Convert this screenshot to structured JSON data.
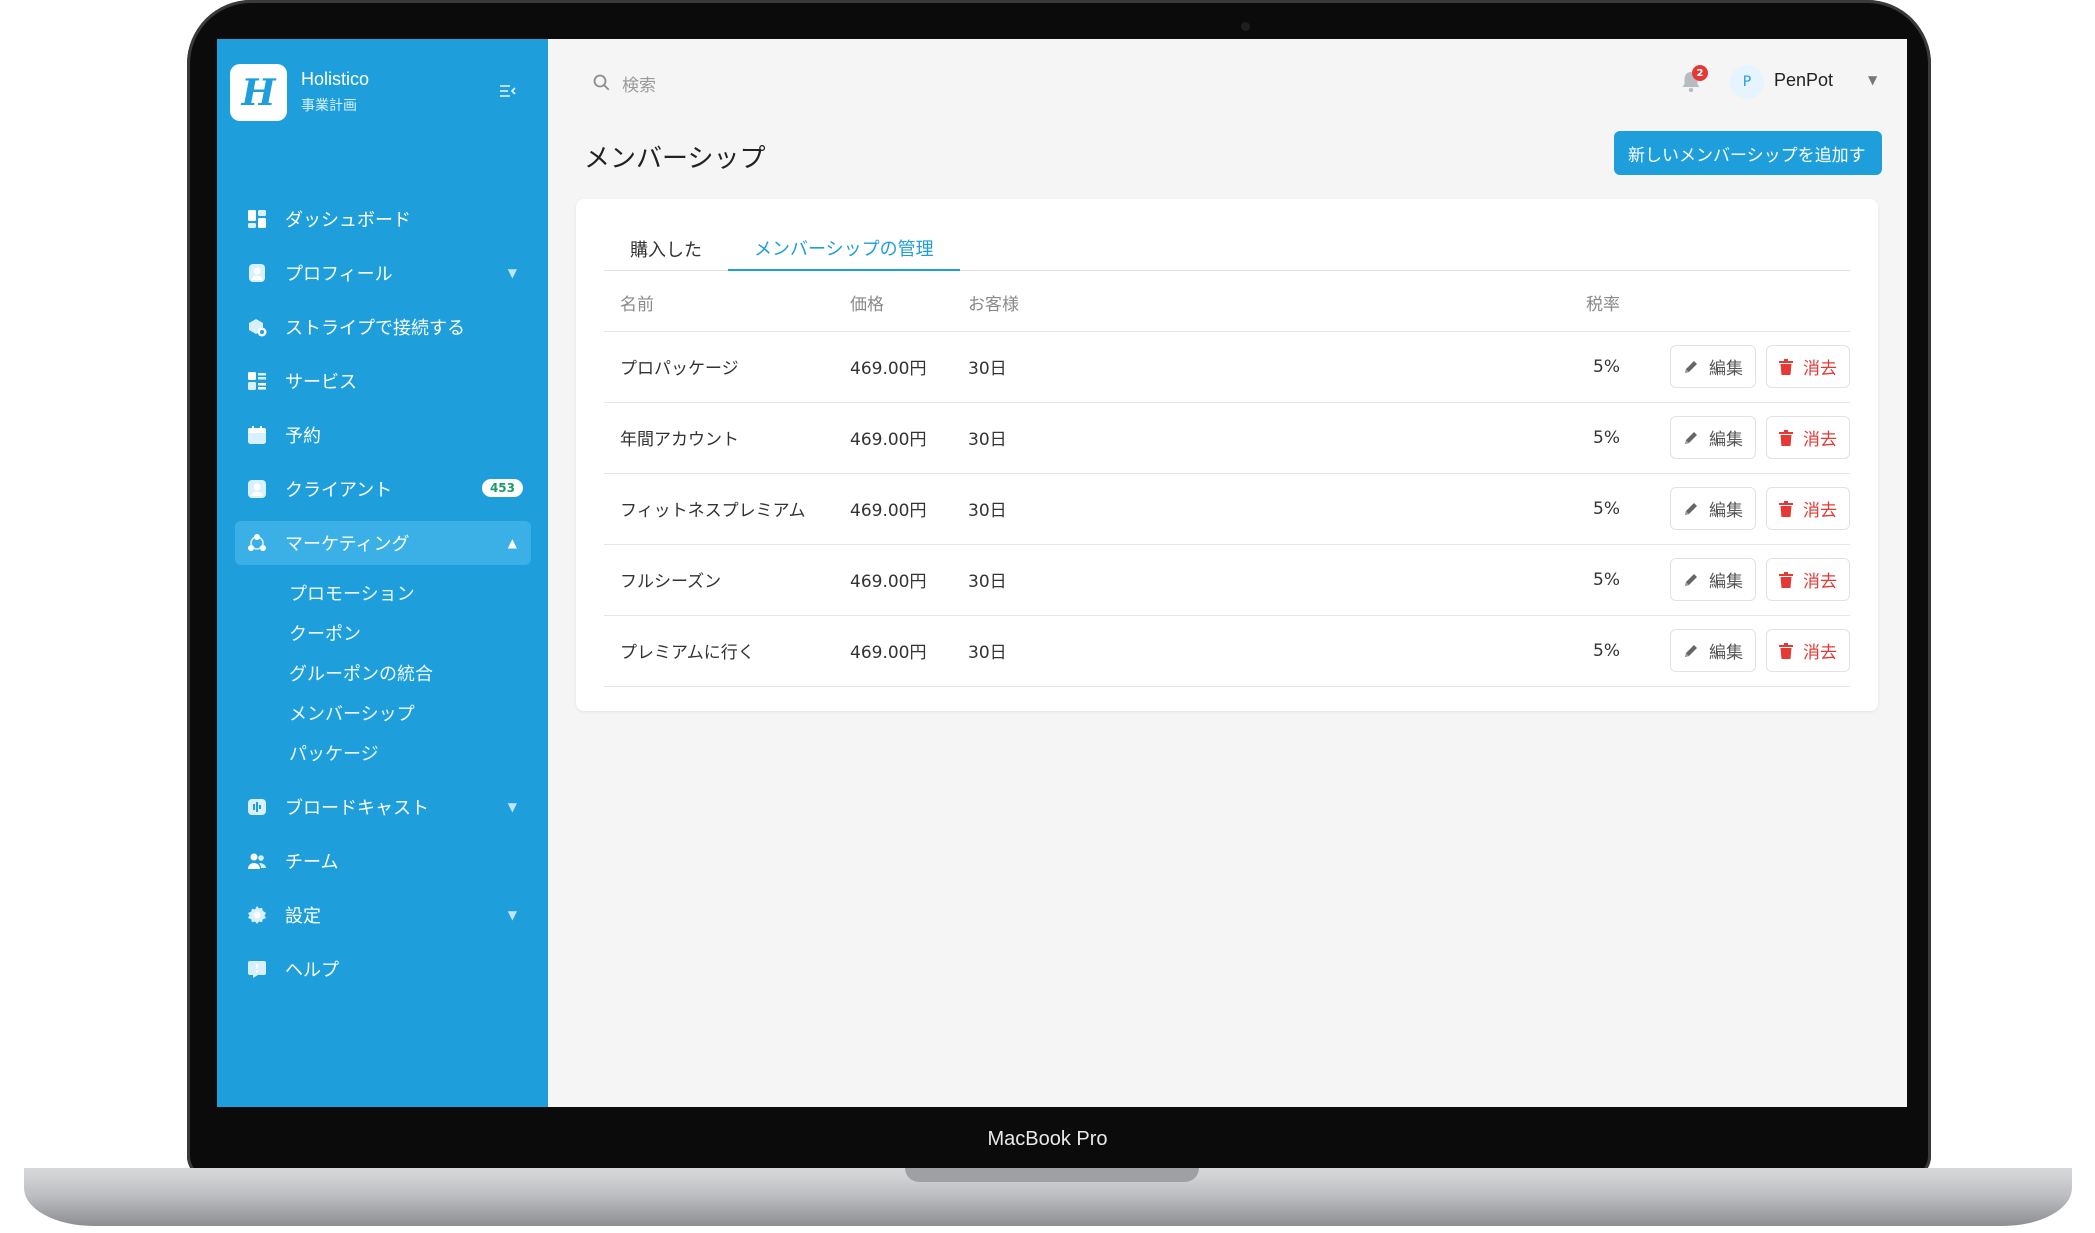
{
  "device": {
    "label": "MacBook Pro"
  },
  "sidebar": {
    "logo_letter": "H",
    "app_name": "Holistico",
    "app_sub": "事業計画",
    "nav": [
      {
        "label": "ダッシュボード",
        "icon": "dashboard-icon"
      },
      {
        "label": "プロフィール",
        "icon": "profile-icon",
        "expandable": true
      },
      {
        "label": "ストライプで接続する",
        "icon": "stripe-connect-icon"
      },
      {
        "label": "サービス",
        "icon": "services-icon"
      },
      {
        "label": "予約",
        "icon": "calendar-icon"
      },
      {
        "label": "クライアント",
        "icon": "client-icon",
        "badge": "453"
      },
      {
        "label": "マーケティング",
        "icon": "marketing-icon",
        "expanded": true
      },
      {
        "label": "ブロードキャスト",
        "icon": "broadcast-icon",
        "expandable": true
      },
      {
        "label": "チーム",
        "icon": "team-icon"
      },
      {
        "label": "設定",
        "icon": "settings-icon",
        "expandable": true
      },
      {
        "label": "ヘルプ",
        "icon": "help-icon"
      }
    ],
    "marketing_sub": [
      "プロモーション",
      "クーポン",
      "グルーポンの統合",
      "メンバーシップ",
      "パッケージ"
    ]
  },
  "header": {
    "search_placeholder": "検索",
    "notification_count": "2",
    "user_initial": "P",
    "user_name": "PenPot"
  },
  "page": {
    "title": "メンバーシップ",
    "add_button": "新しいメンバーシップを追加す"
  },
  "tabs": [
    {
      "label": "購入した",
      "active": false
    },
    {
      "label": "メンバーシップの管理",
      "active": true
    }
  ],
  "table": {
    "headers": [
      "名前",
      "価格",
      "お客様",
      "税率"
    ],
    "rows": [
      {
        "name": "プロパッケージ",
        "price": "469.00円",
        "customers": "30日",
        "tax": "5%"
      },
      {
        "name": "年間アカウント",
        "price": "469.00円",
        "customers": "30日",
        "tax": "5%"
      },
      {
        "name": "フィットネスプレミアム",
        "price": "469.00円",
        "customers": "30日",
        "tax": "5%"
      },
      {
        "name": "フルシーズン",
        "price": "469.00円",
        "customers": "30日",
        "tax": "5%"
      },
      {
        "name": "プレミアムに行く",
        "price": "469.00円",
        "customers": "30日",
        "tax": "5%"
      }
    ],
    "edit_label": "編集",
    "delete_label": "消去"
  },
  "colors": {
    "accent": "#1e9fdb",
    "danger": "#e53935",
    "badge_text": "#1f9a6b"
  }
}
